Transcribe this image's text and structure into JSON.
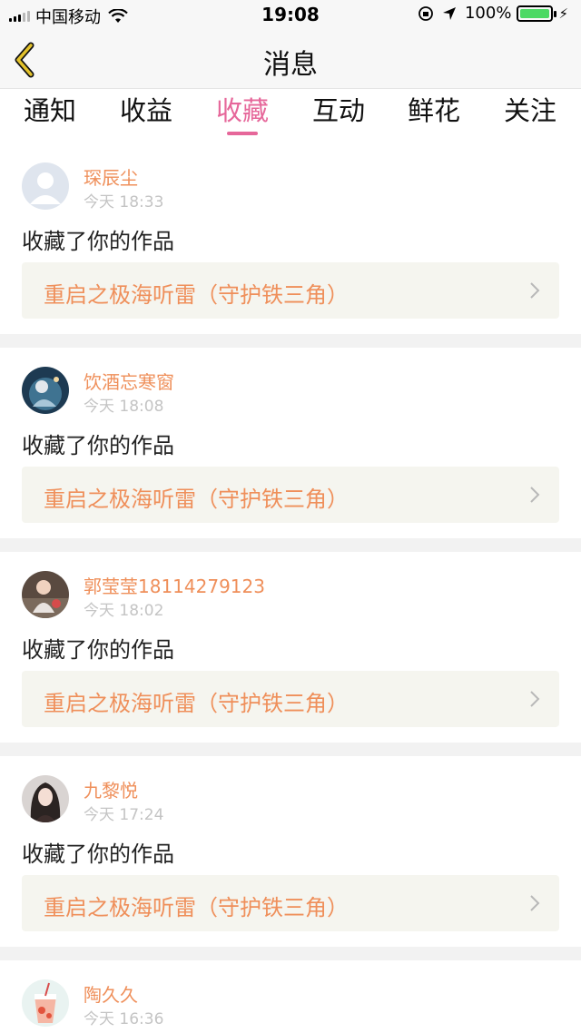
{
  "status_bar": {
    "carrier": "中国移动",
    "time": "19:08",
    "battery": "100%"
  },
  "nav": {
    "title": "消息",
    "back_icon": "chevron-left-icon",
    "accent_color": "#e3c22b"
  },
  "tabs": [
    {
      "label": "通知",
      "active": false
    },
    {
      "label": "收益",
      "active": false
    },
    {
      "label": "收藏",
      "active": true
    },
    {
      "label": "互动",
      "active": false
    },
    {
      "label": "鲜花",
      "active": false
    },
    {
      "label": "关注",
      "active": false
    }
  ],
  "colors": {
    "accent_pink": "#e6679a",
    "username_orange": "#ef8f5a",
    "link_bg": "#f5f5ef"
  },
  "feed": [
    {
      "username": "琛辰尘",
      "time": "今天 18:33",
      "action": "收藏了你的作品",
      "work_title": "重启之极海听雷（守护铁三角）",
      "avatar": "default"
    },
    {
      "username": "饮酒忘寒窗",
      "time": "今天 18:08",
      "action": "收藏了你的作品",
      "work_title": "重启之极海听雷（守护铁三角）",
      "avatar": "photo-dark-blue"
    },
    {
      "username": "郭莹莹18114279123",
      "time": "今天 18:02",
      "action": "收藏了你的作品",
      "work_title": "重启之极海听雷（守护铁三角）",
      "avatar": "photo-child"
    },
    {
      "username": "九黎悦",
      "time": "今天 17:24",
      "action": "收藏了你的作品",
      "work_title": "重启之极海听雷（守护铁三角）",
      "avatar": "photo-portrait"
    },
    {
      "username": "陶久久",
      "time": "今天 16:36",
      "action": "",
      "work_title": "",
      "avatar": "photo-drink"
    }
  ]
}
